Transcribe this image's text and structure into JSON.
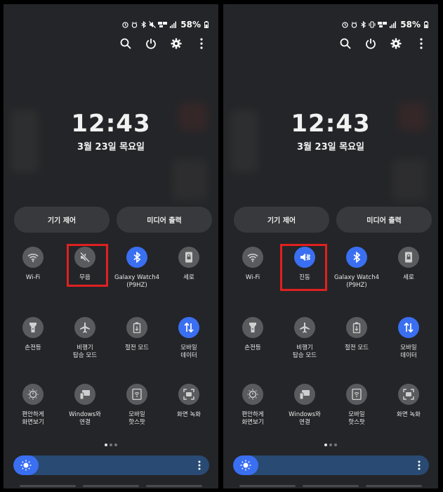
{
  "panels": [
    {
      "status": {
        "battery": "58%"
      },
      "clock": "12:43",
      "date": "3월 23일 목요일",
      "pills": {
        "device_control": "기기 제어",
        "media_output": "미디어 출력"
      },
      "tiles": {
        "wifi": "Wi-Fi",
        "sound": "무음",
        "bluetooth": "Galaxy Watch4\n(P9HZ)",
        "rotation": "세로",
        "flashlight": "손전등",
        "airplane": "비행기\n탑승 모드",
        "power_saving": "절전 모드",
        "mobile_data": "모바일\n데이터",
        "eye_comfort": "편안하게\n화면보기",
        "link_windows": "Windows와\n연결",
        "hotspot": "모바일\n핫스팟",
        "screen_record": "화면 녹화"
      },
      "sound_mode": "mute",
      "page_indicator": {
        "count": 3,
        "active": 1
      },
      "brightness_level": 0.13,
      "highlight_color": "#e02020",
      "accent_color": "#3a6ff1"
    },
    {
      "status": {
        "battery": "58%"
      },
      "clock": "12:43",
      "date": "3월 23일 목요일",
      "pills": {
        "device_control": "기기 제어",
        "media_output": "미디어 출력"
      },
      "tiles": {
        "wifi": "Wi-Fi",
        "sound": "진동",
        "bluetooth": "Galaxy Watch4\n(P9HZ)",
        "rotation": "세로",
        "flashlight": "손전등",
        "airplane": "비행기\n탑승 모드",
        "power_saving": "절전 모드",
        "mobile_data": "모바일\n데이터",
        "eye_comfort": "편안하게\n화면보기",
        "link_windows": "Windows와\n연결",
        "hotspot": "모바일\n핫스팟",
        "screen_record": "화면 녹화"
      },
      "sound_mode": "vibrate",
      "page_indicator": {
        "count": 3,
        "active": 1
      },
      "brightness_level": 0.13,
      "highlight_color": "#e02020",
      "accent_color": "#3a6ff1"
    }
  ]
}
